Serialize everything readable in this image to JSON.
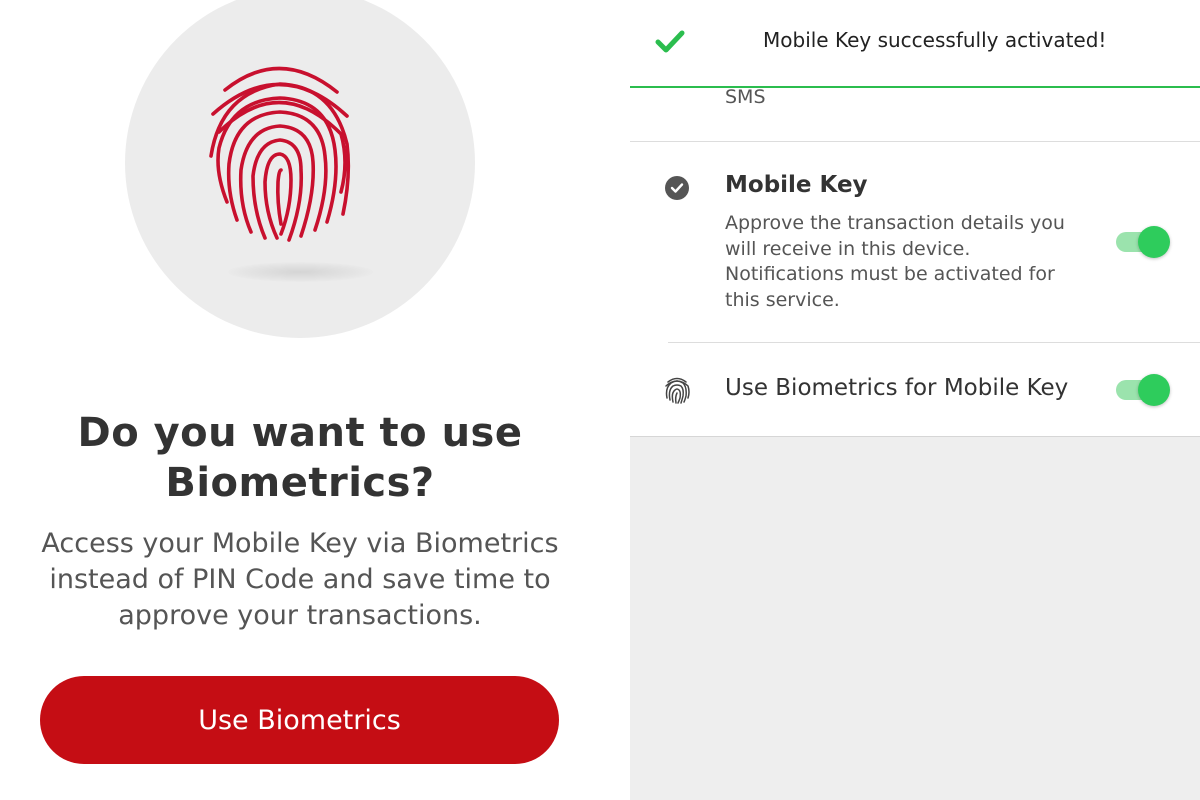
{
  "left": {
    "title": "Do you want to use Biometrics?",
    "description": "Access your Mobile Key via Biometrics instead of PIN Code and save time to approve your transactions.",
    "button_label": "Use Biometrics",
    "icon": "fingerprint-icon"
  },
  "right": {
    "toast": {
      "message": "Mobile Key successfully activated!",
      "icon": "check-icon"
    },
    "sms_label": "SMS",
    "mobile_key": {
      "title": "Mobile Key",
      "description": "Approve the transaction details you will receive in this device. Notifications must be activated for this service.",
      "icon": "check-circle-icon",
      "enabled": true
    },
    "biometrics": {
      "label": "Use Biometrics for Mobile Key",
      "icon": "fingerprint-icon",
      "enabled": true
    }
  },
  "colors": {
    "brand_red": "#c50d14",
    "success_green": "#2bbd4e",
    "toggle_on": "#2ecc5c",
    "text_dark": "#333333"
  }
}
